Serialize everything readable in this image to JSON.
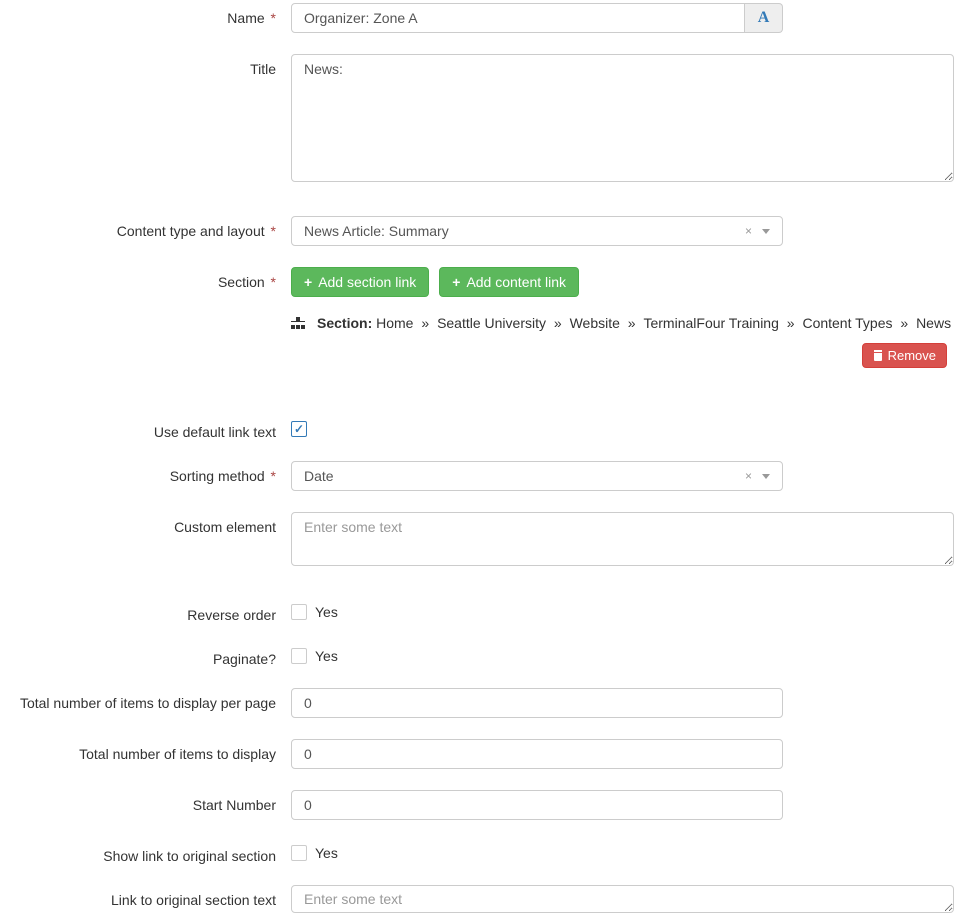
{
  "name": {
    "label": "Name",
    "value": "Organizer: Zone A",
    "addon_icon": "A"
  },
  "title": {
    "label": "Title",
    "value": "News:"
  },
  "content_type": {
    "label": "Content type and layout",
    "value": "News Article: Summary"
  },
  "section": {
    "label": "Section",
    "add_section_btn": "Add section link",
    "add_content_btn": "Add content link",
    "breadcrumb_label": "Section:",
    "crumbs": [
      "Home",
      "Seattle University",
      "Website",
      "TerminalFour Training",
      "Content Types",
      "News"
    ],
    "remove_btn": "Remove"
  },
  "use_default_link": {
    "label": "Use default link text",
    "checked": true
  },
  "sorting": {
    "label": "Sorting method",
    "value": "Date"
  },
  "custom_element": {
    "label": "Custom element",
    "placeholder": "Enter some text"
  },
  "reverse_order": {
    "label": "Reverse order",
    "option": "Yes",
    "checked": false
  },
  "paginate": {
    "label": "Paginate?",
    "option": "Yes",
    "checked": false
  },
  "per_page": {
    "label": "Total number of items to display per page",
    "value": "0"
  },
  "total_items": {
    "label": "Total number of items to display",
    "value": "0"
  },
  "start_number": {
    "label": "Start Number",
    "value": "0"
  },
  "show_orig_link": {
    "label": "Show link to original section",
    "option": "Yes",
    "checked": false
  },
  "orig_link_text": {
    "label": "Link to original section text",
    "placeholder": "Enter some text"
  }
}
